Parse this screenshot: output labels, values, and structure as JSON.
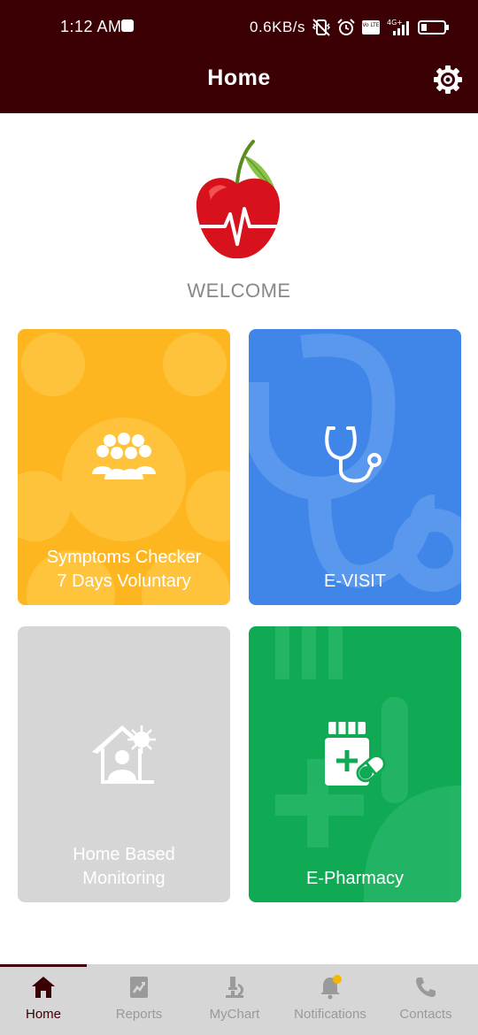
{
  "status_bar": {
    "time": "1:12 AM",
    "network_speed": "0.6KB/s",
    "volte_label": "Vo LTE",
    "network_type": "4G+",
    "battery_level": 5
  },
  "app_bar": {
    "title": "Home",
    "settings_icon": "gear-icon"
  },
  "welcome": {
    "text": "WELCOME"
  },
  "tiles": [
    {
      "name": "symptoms-checker",
      "line1": "Symptoms Checker",
      "line2": "7 Days Voluntary",
      "color": "#FDB61F",
      "icon": "group-icon"
    },
    {
      "name": "e-visit",
      "line1": "",
      "line2": "E-VISIT",
      "color": "#3F86E8",
      "icon": "stethoscope-icon"
    },
    {
      "name": "home-based-monitoring",
      "line1": "Home Based",
      "line2": "Monitoring",
      "color": "#D7D6D7",
      "icon": "house-virus-icon"
    },
    {
      "name": "e-pharmacy",
      "line1": "",
      "line2": "E-Pharmacy",
      "color": "#10AA55",
      "icon": "medicine-icon"
    }
  ],
  "bottom_nav": {
    "active": "Home",
    "items": [
      {
        "label": "Home",
        "icon": "home-icon"
      },
      {
        "label": "Reports",
        "icon": "reports-icon"
      },
      {
        "label": "MyChart",
        "icon": "microscope-icon"
      },
      {
        "label": "Notifications",
        "icon": "bell-icon"
      },
      {
        "label": "Contacts",
        "icon": "phone-icon"
      }
    ]
  },
  "colors": {
    "header": "#3A0004",
    "nav_background": "#D6D6D6",
    "notification_dot": "#F5B800"
  }
}
